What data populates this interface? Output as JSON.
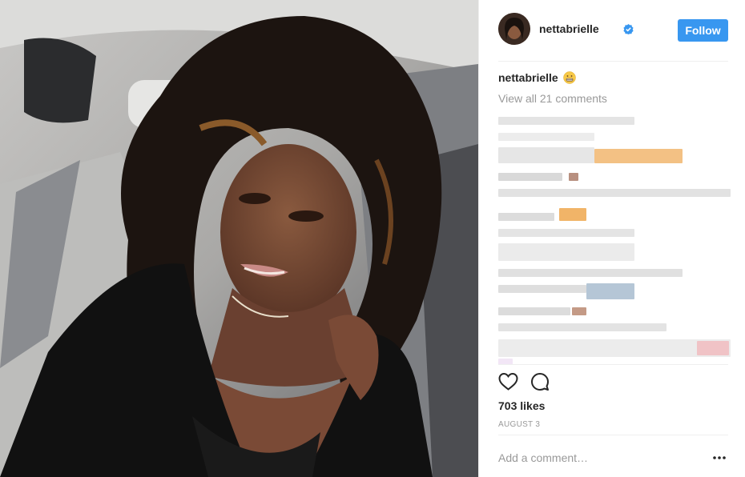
{
  "post": {
    "username": "nettabrielle",
    "follow_label": "Follow",
    "caption_username": "nettabrielle",
    "caption_emoji_icon": "grimacing-face-icon",
    "view_comments_label": "View all 21 comments",
    "likes_label": "703 likes",
    "date_label": "AUGUST 3",
    "add_comment_placeholder": "Add a comment…",
    "accent_color": "#3897f0"
  },
  "icons": {
    "verified": "verified-badge-icon",
    "like": "heart-icon",
    "comment": "comment-bubble-icon",
    "more": "more-options-icon"
  }
}
